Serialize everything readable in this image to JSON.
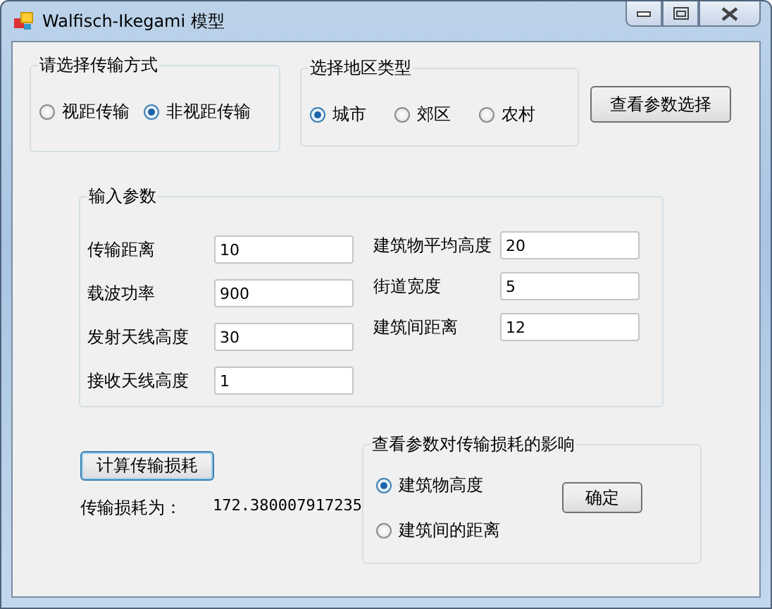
{
  "window": {
    "title": "Walfisch-Ikegami 模型"
  },
  "transmission_mode": {
    "title": "请选择传输方式",
    "options": [
      {
        "label": "视距传输",
        "selected": false
      },
      {
        "label": "非视距传输",
        "selected": true
      }
    ]
  },
  "area_type": {
    "title": "选择地区类型",
    "options": [
      {
        "label": "城市",
        "selected": true
      },
      {
        "label": "郊区",
        "selected": false
      },
      {
        "label": "农村",
        "selected": false
      }
    ]
  },
  "view_params_button": "查看参数选择",
  "inputs": {
    "title": "输入参数",
    "left": [
      {
        "label": "传输距离",
        "value": "10"
      },
      {
        "label": "载波功率",
        "value": "900"
      },
      {
        "label": "发射天线高度",
        "value": "30"
      },
      {
        "label": "接收天线高度",
        "value": "1"
      }
    ],
    "right": [
      {
        "label": "建筑物平均高度",
        "value": "20"
      },
      {
        "label": "街道宽度",
        "value": "5"
      },
      {
        "label": "建筑间距离",
        "value": "12"
      }
    ]
  },
  "calculate_button": "计算传输损耗",
  "result": {
    "label": "传输损耗为：",
    "value": "172.380007917235"
  },
  "influence": {
    "title": "查看参数对传输损耗的影响",
    "options": [
      {
        "label": "建筑物高度",
        "selected": true
      },
      {
        "label": "建筑间的距离",
        "selected": false
      }
    ],
    "confirm_button": "确定"
  }
}
